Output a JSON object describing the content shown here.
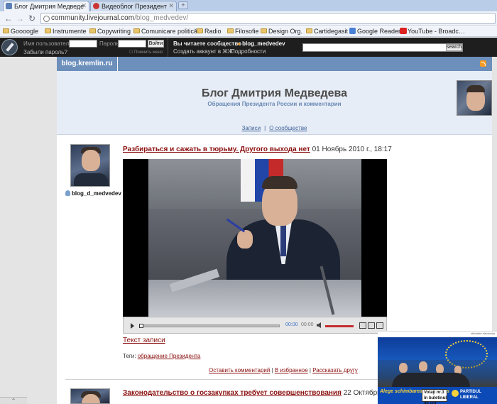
{
  "browser": {
    "tabs": [
      {
        "label": "Блог Дмитрия Медведе",
        "active": true
      },
      {
        "label": "Видеоблог Президент",
        "active": false
      }
    ],
    "new_tab_label": "+",
    "url": {
      "domain": "community.livejournal.com",
      "path": "/blog_medvedev/"
    },
    "bookmarks": [
      {
        "label": "Goooogle",
        "icon": "folder-icon"
      },
      {
        "label": "Instrumente",
        "icon": "folder-icon"
      },
      {
        "label": "Copywriting",
        "icon": "folder-icon"
      },
      {
        "label": "Comunicare politică",
        "icon": "folder-icon"
      },
      {
        "label": "Radio",
        "icon": "folder-icon"
      },
      {
        "label": "Filosofie",
        "icon": "folder-icon"
      },
      {
        "label": "Design Org.",
        "icon": "folder-icon"
      },
      {
        "label": "Cartidegasit",
        "icon": "folder-icon"
      },
      {
        "label": "Google Reader",
        "icon": "google-reader-icon"
      },
      {
        "label": "YouTube - Broadc…",
        "icon": "youtube-icon"
      }
    ]
  },
  "lj_bar": {
    "username_label": "Имя пользователя:",
    "password_label": "Пароль:",
    "login_button": "Войти",
    "forgot_password": "Забыли пароль?",
    "remember_me": "Помнить меня",
    "reading_label": "Вы читаете сообщество",
    "community": "blog_medvedev",
    "create_account": "Создать аккаунт в ЖЖ",
    "details": "Подробности",
    "search_button": "search"
  },
  "blog": {
    "tag": "blog.kremlin.ru",
    "title": "Блог Дмитрия Медведева",
    "subtitle": "Обращения Президента России и комментарии",
    "nav": {
      "entries": "Записи",
      "separator": "|",
      "about": "О сообществе"
    }
  },
  "posts": [
    {
      "author": "blog_d_medvedev",
      "title": "Разбираться и сажать в тюрьму. Другого выхода нет",
      "date": "01 Ноябрь 2010 г., 18:17",
      "player": {
        "current_time": "00:00",
        "total_time": "00:00"
      },
      "text_link": "Текст записи",
      "tags_label": "Теги:",
      "tag": "обращение Президента",
      "actions": {
        "comment": "Оставить комментарий",
        "favorites": "В избранное",
        "share": "Рассказать другу",
        "separator": " | "
      }
    },
    {
      "title": "Законодательство о госзакупках требует совершенствования",
      "date": "22 Октябрь 2010 г., 14"
    }
  ],
  "ad": {
    "label": "ublicitate electorala",
    "slogan": "Alege schimbarea pas cu pas",
    "vote": "Votaţi nr.3 în buletinul de vot",
    "party": "PARTIDUL LIBERAL"
  },
  "colors": {
    "link": "#8b1010",
    "header_bg": "#e7edf7",
    "strip": "#6d8fbb",
    "lj_bar": "#1e1e1e"
  }
}
